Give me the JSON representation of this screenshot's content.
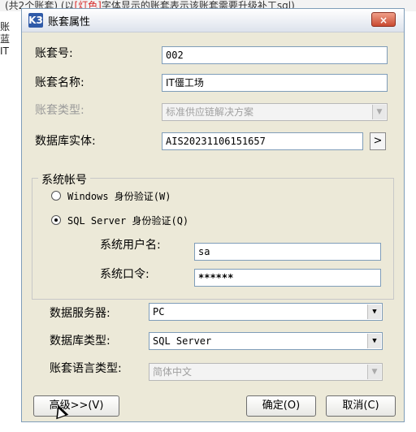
{
  "background": {
    "top_text_prefix": "(共2个账套) (以",
    "top_text_red": "[灯色]",
    "top_text_suffix": "字体显示的账套表示该账套需要升级补工sql)",
    "left_items": [
      "账",
      "蓝",
      "IT"
    ]
  },
  "dialog": {
    "title": "账套属性",
    "app_icon_text": "K3",
    "close_label": "×"
  },
  "fields": {
    "account_no_label": "账套号:",
    "account_no_value": "002",
    "account_name_label": "账套名称:",
    "account_name_value": "IT僵工场",
    "account_type_label": "账套类型:",
    "account_type_value": "标准供应链解决方案",
    "db_entity_label": "数据库实体:",
    "db_entity_value": "AIS20231106151657",
    "browse_label": ">"
  },
  "system_account": {
    "group_title": "系统帐号",
    "windows_auth_label": "Windows 身份验证(W)",
    "sql_auth_label": "SQL Server 身份验证(Q)",
    "selected": "sql",
    "username_label": "系统用户名:",
    "username_value": "sa",
    "password_label": "系统口令:",
    "password_value": "******"
  },
  "server": {
    "data_server_label": "数据服务器:",
    "data_server_value": "PC",
    "db_type_label": "数据库类型:",
    "db_type_value": "SQL Server",
    "language_label": "账套语言类型:",
    "language_value": "简体中文"
  },
  "buttons": {
    "advanced": "高级>>(V)",
    "ok": "确定(O)",
    "cancel": "取消(C)"
  }
}
